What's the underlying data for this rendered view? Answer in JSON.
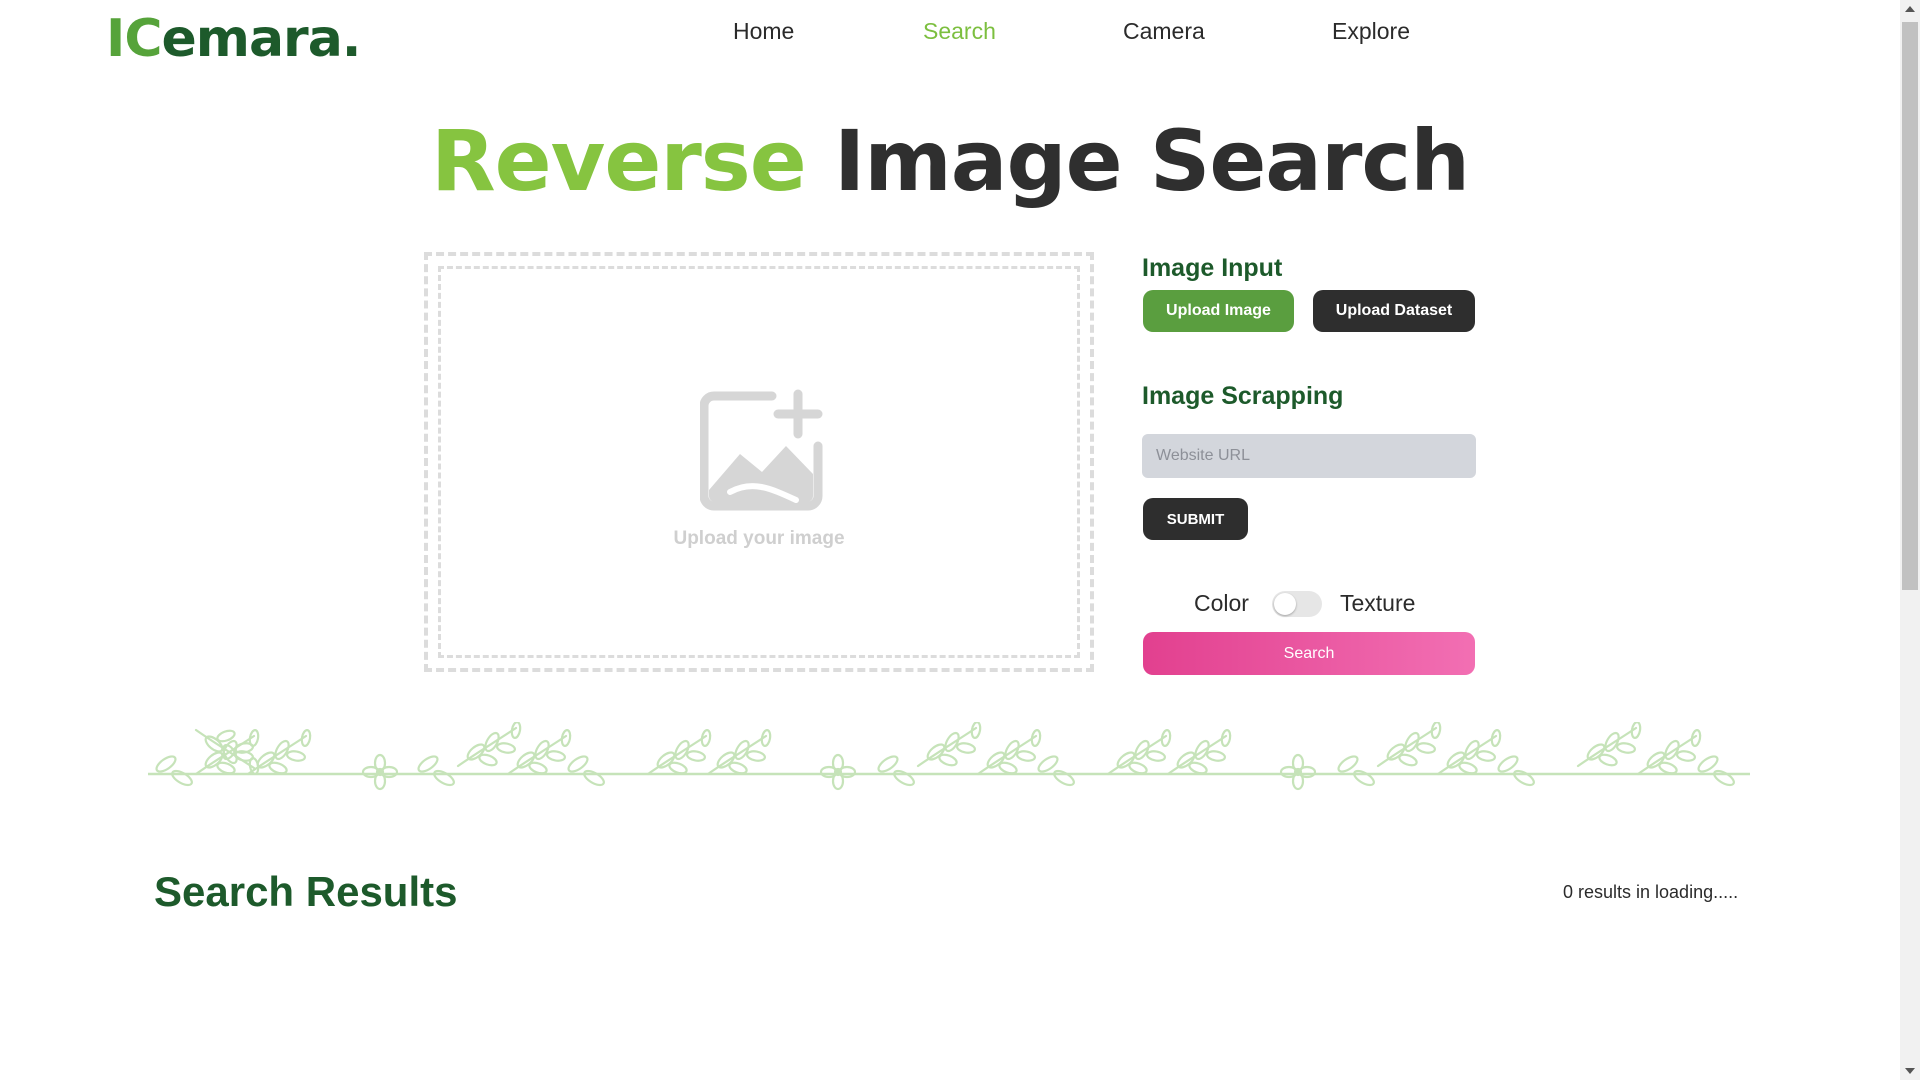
{
  "brand": {
    "logo_part1": "IC",
    "logo_part2": "emara."
  },
  "nav": {
    "items": [
      {
        "label": "Home"
      },
      {
        "label": "Search"
      },
      {
        "label": "Camera"
      },
      {
        "label": "Explore"
      }
    ],
    "active": "Search"
  },
  "hero": {
    "title_accent": "Reverse",
    "title_rest": " Image Search"
  },
  "dropzone": {
    "label": "Upload your image",
    "icon": "image-add-icon"
  },
  "image_input": {
    "title": "Image Input",
    "upload_image_label": "Upload Image",
    "upload_dataset_label": "Upload Dataset"
  },
  "image_scrapping": {
    "title": "Image Scrapping",
    "url_placeholder": "Website URL",
    "url_value": "",
    "submit_label": "SUBMIT"
  },
  "mode_toggle": {
    "left_label": "Color",
    "right_label": "Texture",
    "state": "off"
  },
  "search_button_label": "Search",
  "results": {
    "title": "Search Results",
    "status": "0 results in loading....."
  },
  "colors": {
    "brand_green": "#1d5a2b",
    "accent_green": "#86c440",
    "button_green": "#5a9e3f",
    "dark_button": "#2e2e2e",
    "search_gradient_start": "#e2408f",
    "search_gradient_end": "#f26fb3"
  }
}
